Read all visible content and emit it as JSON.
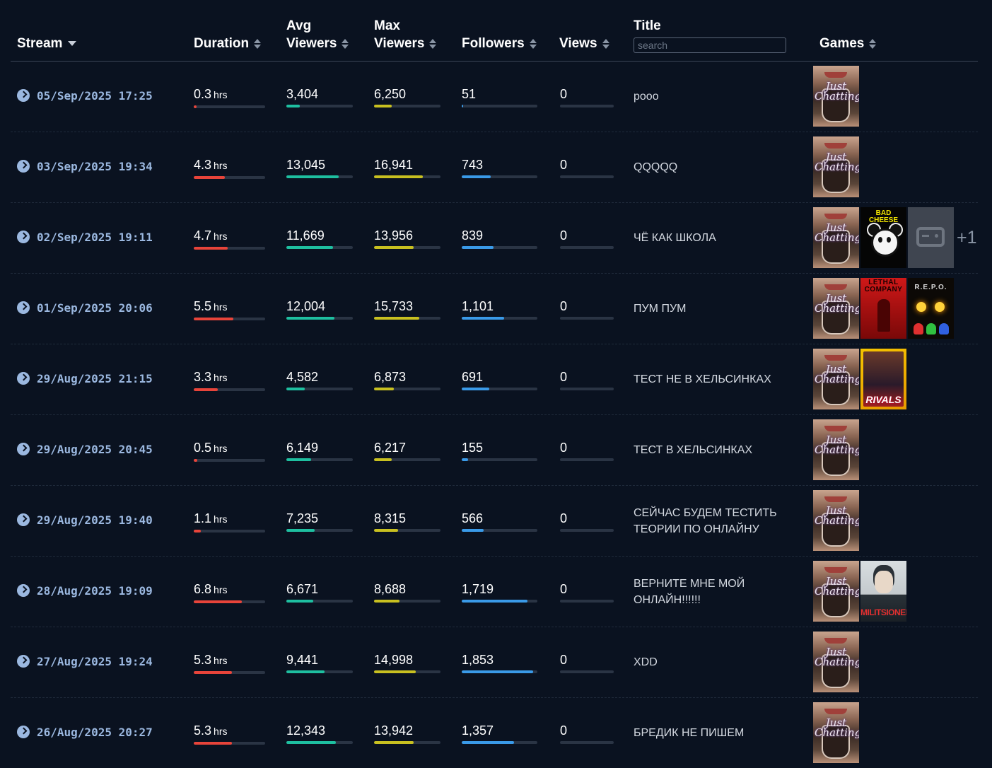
{
  "columns": {
    "stream": "Stream",
    "duration": "Duration",
    "avg_viewers_1": "Avg",
    "avg_viewers_2": "Viewers",
    "max_viewers_1": "Max",
    "max_viewers_2": "Viewers",
    "followers": "Followers",
    "views": "Views",
    "title": "Title",
    "games": "Games"
  },
  "search_placeholder": "search",
  "duration_unit": "hrs",
  "colors": {
    "duration": "#e8443a",
    "avg": "#1ebfa0",
    "max": "#c8c020",
    "followers": "#3a9ae8"
  },
  "rows": [
    {
      "stream": "05/Sep/2025 17:25",
      "duration": "0.3",
      "duration_frac": 0.04,
      "avg": "3,404",
      "avg_frac": 0.2,
      "max": "6,250",
      "max_frac": 0.27,
      "followers": "51",
      "followers_frac": 0.02,
      "views": "0",
      "views_frac": 0,
      "title": "pooo",
      "games": [
        "jc"
      ],
      "more": ""
    },
    {
      "stream": "03/Sep/2025 19:34",
      "duration": "4.3",
      "duration_frac": 0.44,
      "avg": "13,045",
      "avg_frac": 0.79,
      "max": "16,941",
      "max_frac": 0.73,
      "followers": "743",
      "followers_frac": 0.38,
      "views": "0",
      "views_frac": 0,
      "title": "QQQQQ",
      "games": [
        "jc"
      ],
      "more": ""
    },
    {
      "stream": "02/Sep/2025 19:11",
      "duration": "4.7",
      "duration_frac": 0.48,
      "avg": "11,669",
      "avg_frac": 0.7,
      "max": "13,956",
      "max_frac": 0.6,
      "followers": "839",
      "followers_frac": 0.42,
      "views": "0",
      "views_frac": 0,
      "title": "ЧЁ КАК ШКОЛА",
      "games": [
        "jc",
        "bc",
        "ph"
      ],
      "more": "+1"
    },
    {
      "stream": "01/Sep/2025 20:06",
      "duration": "5.5",
      "duration_frac": 0.55,
      "avg": "12,004",
      "avg_frac": 0.72,
      "max": "15,733",
      "max_frac": 0.68,
      "followers": "1,101",
      "followers_frac": 0.56,
      "views": "0",
      "views_frac": 0,
      "title": "ПУМ ПУМ",
      "games": [
        "jc",
        "lc",
        "rp"
      ],
      "more": ""
    },
    {
      "stream": "29/Aug/2025 21:15",
      "duration": "3.3",
      "duration_frac": 0.34,
      "avg": "4,582",
      "avg_frac": 0.28,
      "max": "6,873",
      "max_frac": 0.3,
      "followers": "691",
      "followers_frac": 0.36,
      "views": "0",
      "views_frac": 0,
      "title": "ТЕСТ НЕ В ХЕЛЬСИНКАХ",
      "games": [
        "jc",
        "mr"
      ],
      "more": ""
    },
    {
      "stream": "29/Aug/2025 20:45",
      "duration": "0.5",
      "duration_frac": 0.05,
      "avg": "6,149",
      "avg_frac": 0.37,
      "max": "6,217",
      "max_frac": 0.27,
      "followers": "155",
      "followers_frac": 0.08,
      "views": "0",
      "views_frac": 0,
      "title": "ТЕСТ В ХЕЛЬСИНКАХ",
      "games": [
        "jc"
      ],
      "more": ""
    },
    {
      "stream": "29/Aug/2025 19:40",
      "duration": "1.1",
      "duration_frac": 0.1,
      "avg": "7,235",
      "avg_frac": 0.43,
      "max": "8,315",
      "max_frac": 0.36,
      "followers": "566",
      "followers_frac": 0.29,
      "views": "0",
      "views_frac": 0,
      "title": "СЕЙЧАС БУДЕМ ТЕСТИТЬ ТЕОРИИ ПО ОНЛАЙНУ",
      "games": [
        "jc"
      ],
      "more": ""
    },
    {
      "stream": "28/Aug/2025 19:09",
      "duration": "6.8",
      "duration_frac": 0.67,
      "avg": "6,671",
      "avg_frac": 0.4,
      "max": "8,688",
      "max_frac": 0.38,
      "followers": "1,719",
      "followers_frac": 0.87,
      "views": "0",
      "views_frac": 0,
      "title": "ВЕРНИТЕ МНЕ МОЙ ОНЛАЙН!!!!!!",
      "games": [
        "jc",
        "mi"
      ],
      "more": ""
    },
    {
      "stream": "27/Aug/2025 19:24",
      "duration": "5.3",
      "duration_frac": 0.53,
      "avg": "9,441",
      "avg_frac": 0.57,
      "max": "14,998",
      "max_frac": 0.63,
      "followers": "1,853",
      "followers_frac": 0.94,
      "views": "0",
      "views_frac": 0,
      "title": "XDD",
      "games": [
        "jc"
      ],
      "more": ""
    },
    {
      "stream": "26/Aug/2025 20:27",
      "duration": "5.3",
      "duration_frac": 0.53,
      "avg": "12,343",
      "avg_frac": 0.74,
      "max": "13,942",
      "max_frac": 0.6,
      "followers": "1,357",
      "followers_frac": 0.69,
      "views": "0",
      "views_frac": 0,
      "title": "БРЕДИК НЕ ПИШЕМ",
      "games": [
        "jc"
      ],
      "more": ""
    }
  ],
  "game_art": {
    "jc_text": "Just Chatting",
    "bc_text": "BAD CHEESE",
    "lc_text": "LETHAL COMPANY",
    "rp_text": "R.E.P.O.",
    "mr_text": "RIVALS",
    "mi_text": "MILITSIONER"
  }
}
